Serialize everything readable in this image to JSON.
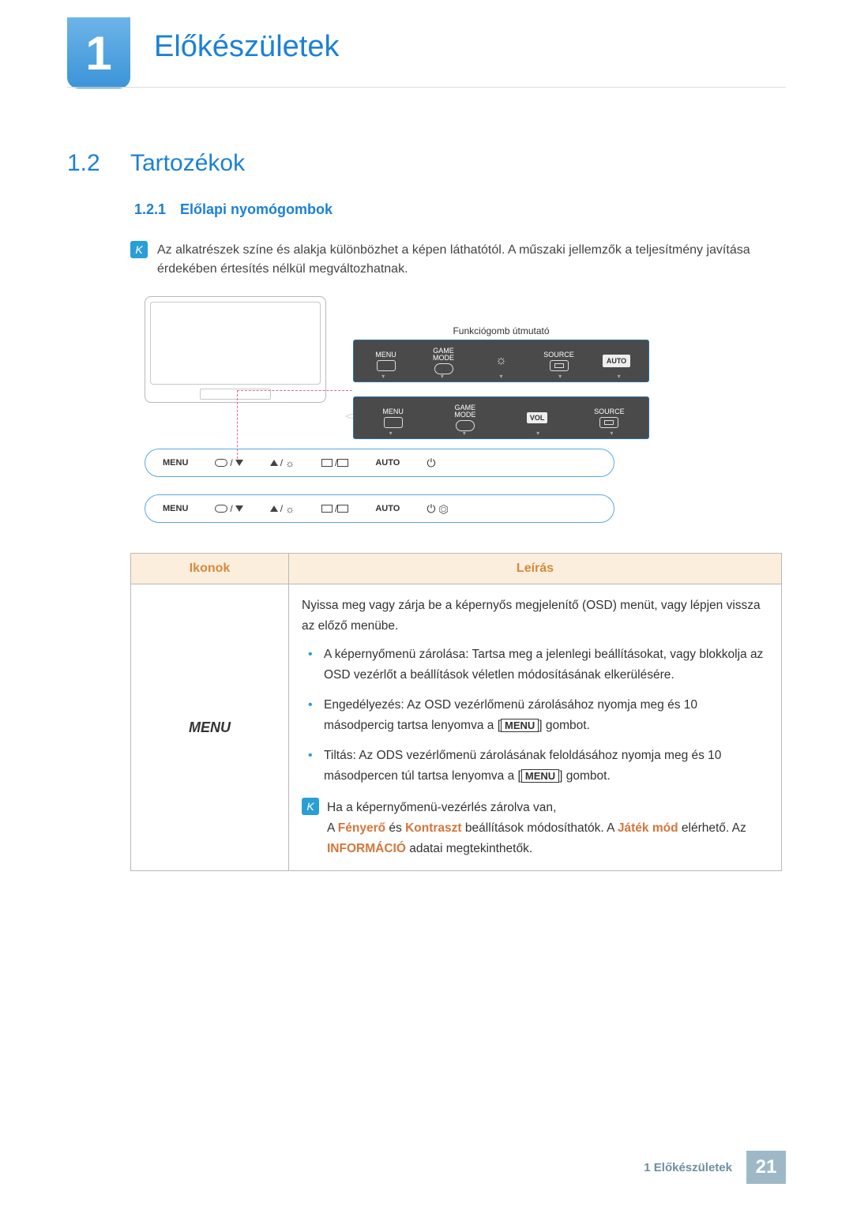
{
  "chapter": {
    "number": "1",
    "title": "Előkészületek"
  },
  "section": {
    "number": "1.2",
    "title": "Tartozékok"
  },
  "subsection": {
    "number": "1.2.1",
    "title": "Előlapi nyomógombok"
  },
  "note1": "Az alkatrészek színe és alakja különbözhet a képen láthatótól. A műszaki jellemzők a teljesítmény javítása érdekében értesítés nélkül megváltozhatnak.",
  "diagram": {
    "func_guide": "Funkciógomb útmutató",
    "panel1": {
      "menu": "MENU",
      "game": "GAME\nMODE",
      "source": "SOURCE",
      "auto": "AUTO"
    },
    "panel2": {
      "menu": "MENU",
      "game": "GAME\nMODE",
      "vol": "VOL",
      "source": "SOURCE"
    },
    "bars": {
      "menu": "MENU",
      "auto": "AUTO"
    }
  },
  "table": {
    "head_icons": "Ikonok",
    "head_desc": "Leírás",
    "icon_label": "MENU",
    "desc_intro": "Nyissa meg vagy zárja be a képernyős megjelenítő (OSD) menüt, vagy lépjen vissza az előző menübe.",
    "bullets": [
      "A képernyőmenü zárolása: Tartsa meg a jelenlegi beállításokat, vagy blokkolja az OSD vezérlőt a beállítások véletlen módosításának elkerülésére.",
      "Engedélyezés: Az OSD vezérlőmenü zárolásához nyomja meg és 10 másodpercig tartsa lenyomva a ",
      "Tiltás: Az ODS vezérlőmenü zárolásának feloldásához nyomja meg és 10 másodpercen túl tartsa lenyomva a "
    ],
    "menu_btn": "MENU",
    "bullet_suffix": " gombot.",
    "note2_line1": "Ha a képernyőmenü-vezérlés zárolva van,",
    "note2_line2_a": "A ",
    "note2_hl1": "Fényerő",
    "note2_mid1": " és ",
    "note2_hl2": "Kontraszt",
    "note2_mid2": " beállítások módosíthatók. A ",
    "note2_hl3": "Játék mód",
    "note2_mid3": " elérhető. Az ",
    "note2_hl4": "INFORMÁCIÓ",
    "note2_end": " adatai megtekinthetők."
  },
  "footer": {
    "text": "1 Előkészületek",
    "page": "21"
  }
}
